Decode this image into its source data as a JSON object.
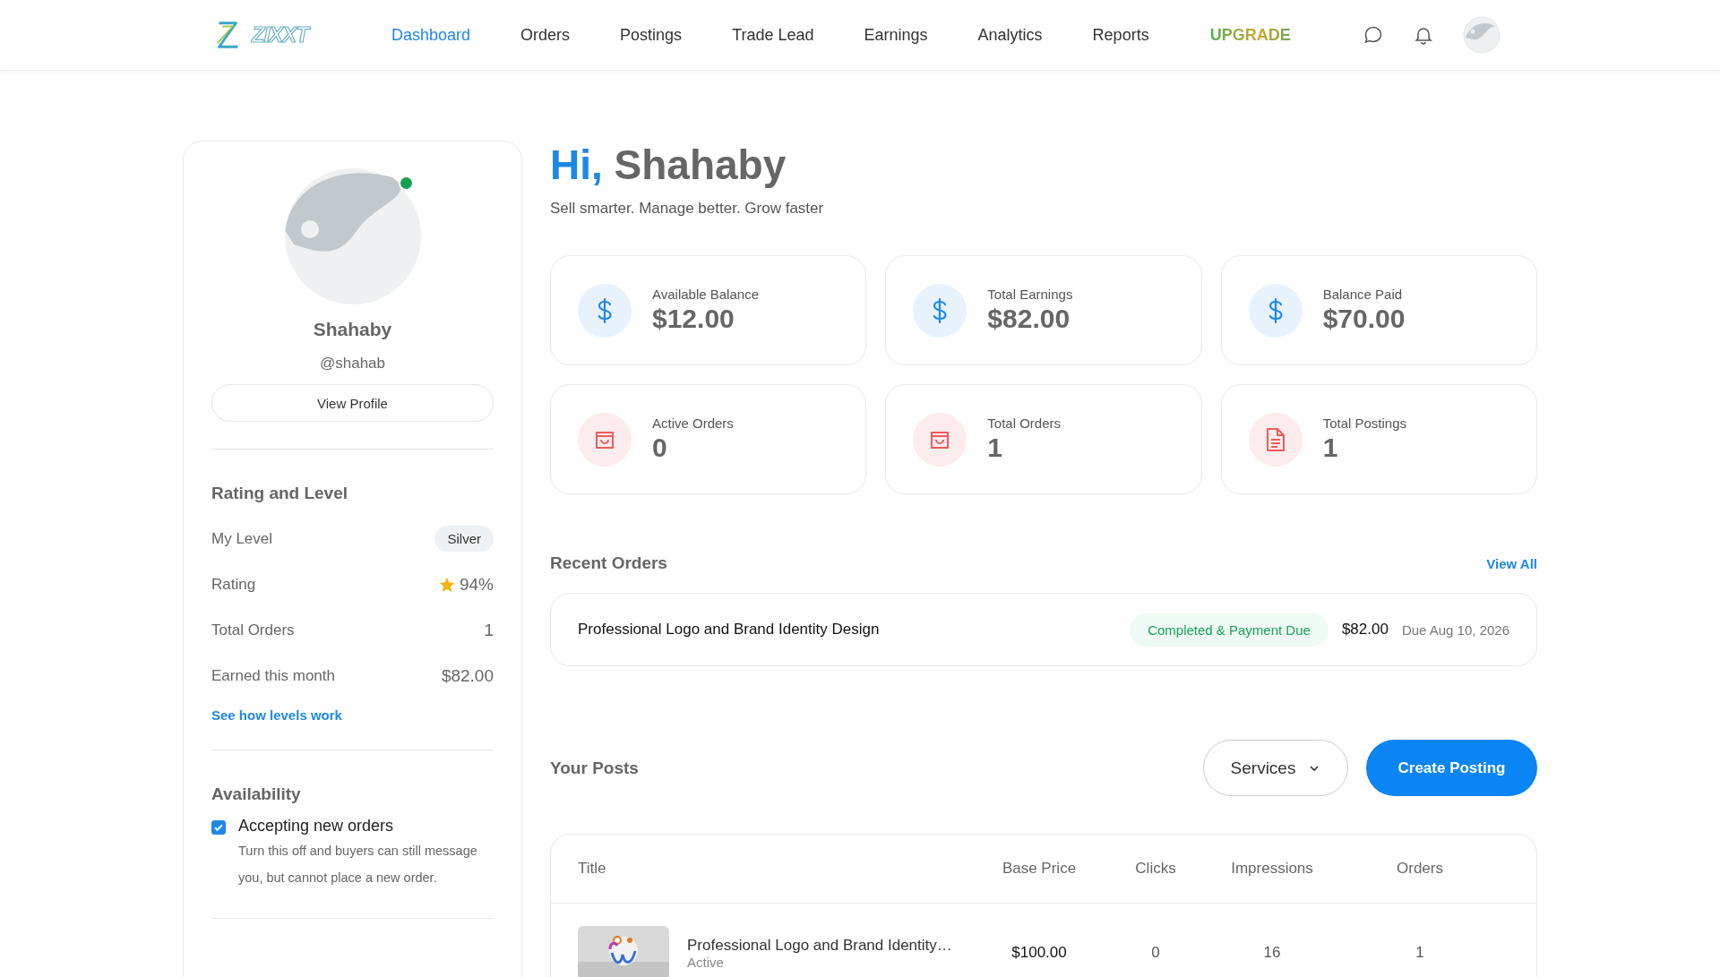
{
  "header": {
    "logo": "ZIXXT",
    "nav": [
      {
        "label": "Dashboard",
        "selected": true,
        "kind": "link"
      },
      {
        "label": "Orders",
        "selected": false,
        "kind": "link"
      },
      {
        "label": "Postings",
        "selected": false,
        "kind": "link"
      },
      {
        "label": "Trade Lead",
        "selected": false,
        "kind": "link"
      },
      {
        "label": "Earnings",
        "selected": false,
        "kind": "link"
      },
      {
        "label": "Analytics",
        "selected": false,
        "kind": "link"
      },
      {
        "label": "Reports",
        "selected": false,
        "kind": "link"
      },
      {
        "label": "UPGRADE",
        "selected": false,
        "kind": "upgrade"
      }
    ]
  },
  "profile": {
    "name": "Shahaby",
    "handle": "@shahab",
    "online": true,
    "view_button": "View Profile",
    "rating_title": "Rating and Level",
    "stats": [
      {
        "label": "My Level",
        "value": "Silver",
        "kind": "badge"
      },
      {
        "label": "Rating",
        "value": "94%",
        "kind": "star"
      },
      {
        "label": "Total Orders",
        "value": "1",
        "kind": "plain"
      },
      {
        "label": "Earned this month",
        "value": "$82.00",
        "kind": "plain"
      }
    ],
    "levels_link": "See how levels work",
    "availability_title": "Availability",
    "accepting": {
      "label": "Accepting new orders",
      "checked": true,
      "hint": "Turn this off and buyers can still message you, but cannot place a new order."
    }
  },
  "greeting": {
    "hi": "Hi,",
    "name": "Shahaby",
    "tagline": "Sell smarter. Manage better. Grow faster"
  },
  "stat_cards": [
    {
      "label": "Available Balance",
      "value": "$12.00",
      "kind": "money"
    },
    {
      "label": "Total Earnings",
      "value": "$82.00",
      "kind": "money"
    },
    {
      "label": "Balance Paid",
      "value": "$70.00",
      "kind": "money"
    },
    {
      "label": "Active Orders",
      "value": "0",
      "kind": "orders"
    },
    {
      "label": "Total Orders",
      "value": "1",
      "kind": "orders"
    },
    {
      "label": "Total Postings",
      "value": "1",
      "kind": "postings"
    }
  ],
  "recent_orders": {
    "title": "Recent Orders",
    "view_all": "View All",
    "orders": [
      {
        "title": "Professional Logo and Brand Identity Design",
        "status": "Completed & Payment Due",
        "price": "$82.00",
        "due": "Due Aug 10, 2026"
      }
    ]
  },
  "posts": {
    "title": "Your Posts",
    "filter": "Services",
    "create_button": "Create Posting",
    "columns": [
      "Title",
      "Base Price",
      "Clicks",
      "Impressions",
      "Orders"
    ],
    "rows": [
      {
        "title": "Professional Logo and Brand Identity…",
        "status": "Active",
        "price": "$100.00",
        "clicks": "0",
        "impressions": "16",
        "orders": "1"
      }
    ]
  }
}
